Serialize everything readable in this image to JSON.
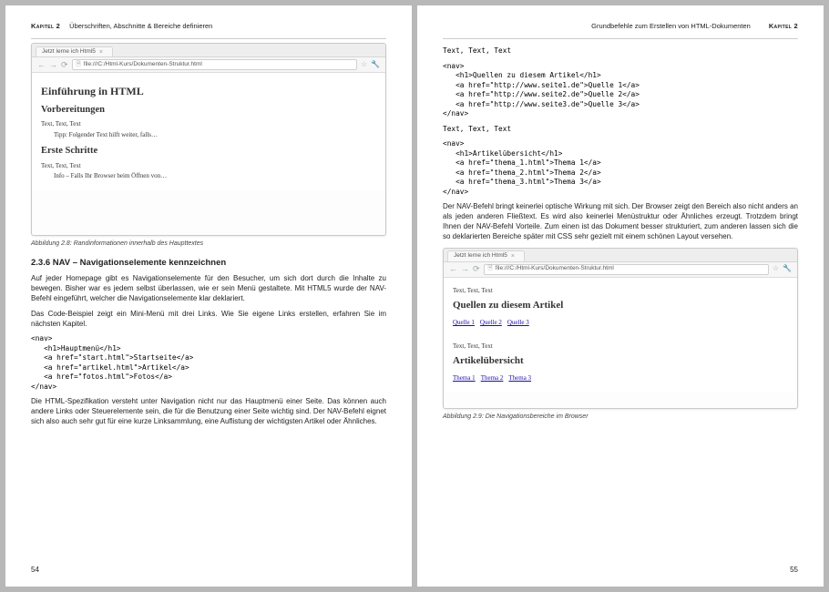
{
  "chapter_label": "Kapitel 2",
  "left_header_title": "Überschriften, Abschnitte & Bereiche definieren",
  "right_header_title": "Grundbefehle zum Erstellen von HTML-Dokumenten",
  "left_page_number": "54",
  "right_page_number": "55",
  "browser_tab_title": "Jetzt lerne ich Html5",
  "browser_url": "file:///C:/Html-Kurs/Dokumenten-Struktur.html",
  "fig28": {
    "h1": "Einführung in HTML",
    "h2a": "Vorbereitungen",
    "p1": "Text, Text, Text",
    "tipp": "Tipp: Folgender Text hilft weiter, falls…",
    "h2b": "Erste Schritte",
    "p2": "Text, Text, Text",
    "info": "Info – Falls Ihr Browser beim Öffnen von…",
    "caption": "Abbildung 2.8:  Randinformationen innerhalb des Haupttextes"
  },
  "section": {
    "number_title": "2.3.6    NAV – Navigationselemente kennzeichnen",
    "p1": "Auf jeder Homepage gibt es Navigationselemente für den Besucher, um sich dort durch die Inhalte zu bewegen. Bisher war es jedem selbst überlassen, wie er sein Menü gestaltete. Mit HTML5 wurde der NAV-Befehl eingeführt, welcher die Navigationselemente klar deklariert.",
    "p2": "Das Code-Beispiel zeigt ein Mini-Menü mit drei Links. Wie Sie eigene Links erstellen, erfahren Sie im nächsten Kapitel.",
    "code1": "<nav>\n   <h1>Hauptmenü</h1>\n   <a href=\"start.html\">Startseite</a>\n   <a href=\"artikel.html\">Artikel</a>\n   <a href=\"fotos.html\">Fotos</a>\n</nav>",
    "p3": "Die HTML-Spezifikation versteht unter Navigation nicht nur das Hauptmenü einer Seite. Das können auch andere Links oder Steuerelemente sein, die für die Benutzung einer Seite wichtig sind. Der NAV-Befehl eignet sich also auch sehr gut für eine kurze Linksammlung, eine Auflistung der wichtigsten Artikel oder Ähnliches."
  },
  "right": {
    "text_placeholder": "Text, Text, Text",
    "code_top": "<nav>\n   <h1>Quellen zu diesem Artikel</h1>\n   <a href=\"http://www.seite1.de\">Quelle 1</a>\n   <a href=\"http://www.seite2.de\">Quelle 2</a>\n   <a href=\"http://www.seite3.de\">Quelle 3</a>\n</nav>",
    "code_bottom": "<nav>\n   <h1>Artikelübersicht</h1>\n   <a href=\"thema_1.html\">Thema 1</a>\n   <a href=\"thema_2.html\">Thema 2</a>\n   <a href=\"thema_3.html\">Thema 3</a>\n</nav>",
    "para": "Der NAV-Befehl bringt keinerlei optische Wirkung mit sich. Der Browser zeigt den Bereich also nicht anders an als jeden anderen Fließtext. Es wird also keinerlei Menüstruktur oder Ähnliches erzeugt. Trotzdem bringt Ihnen der NAV-Befehl Vorteile. Zum einen ist das Dokument besser strukturiert, zum anderen lassen sich die so deklarierten Bereiche später mit CSS sehr gezielt mit einem schönen Layout versehen."
  },
  "fig29": {
    "p1": "Text, Text, Text",
    "h1a": "Quellen zu diesem Artikel",
    "links_a": [
      "Quelle 1",
      "Quelle 2",
      "Quelle 3"
    ],
    "p2": "Text, Text, Text",
    "h1b": "Artikelübersicht",
    "links_b": [
      "Thema 1",
      "Thema 2",
      "Thema 3"
    ],
    "caption": "Abbildung 2.9:  Die Navigationsbereiche im Browser"
  }
}
